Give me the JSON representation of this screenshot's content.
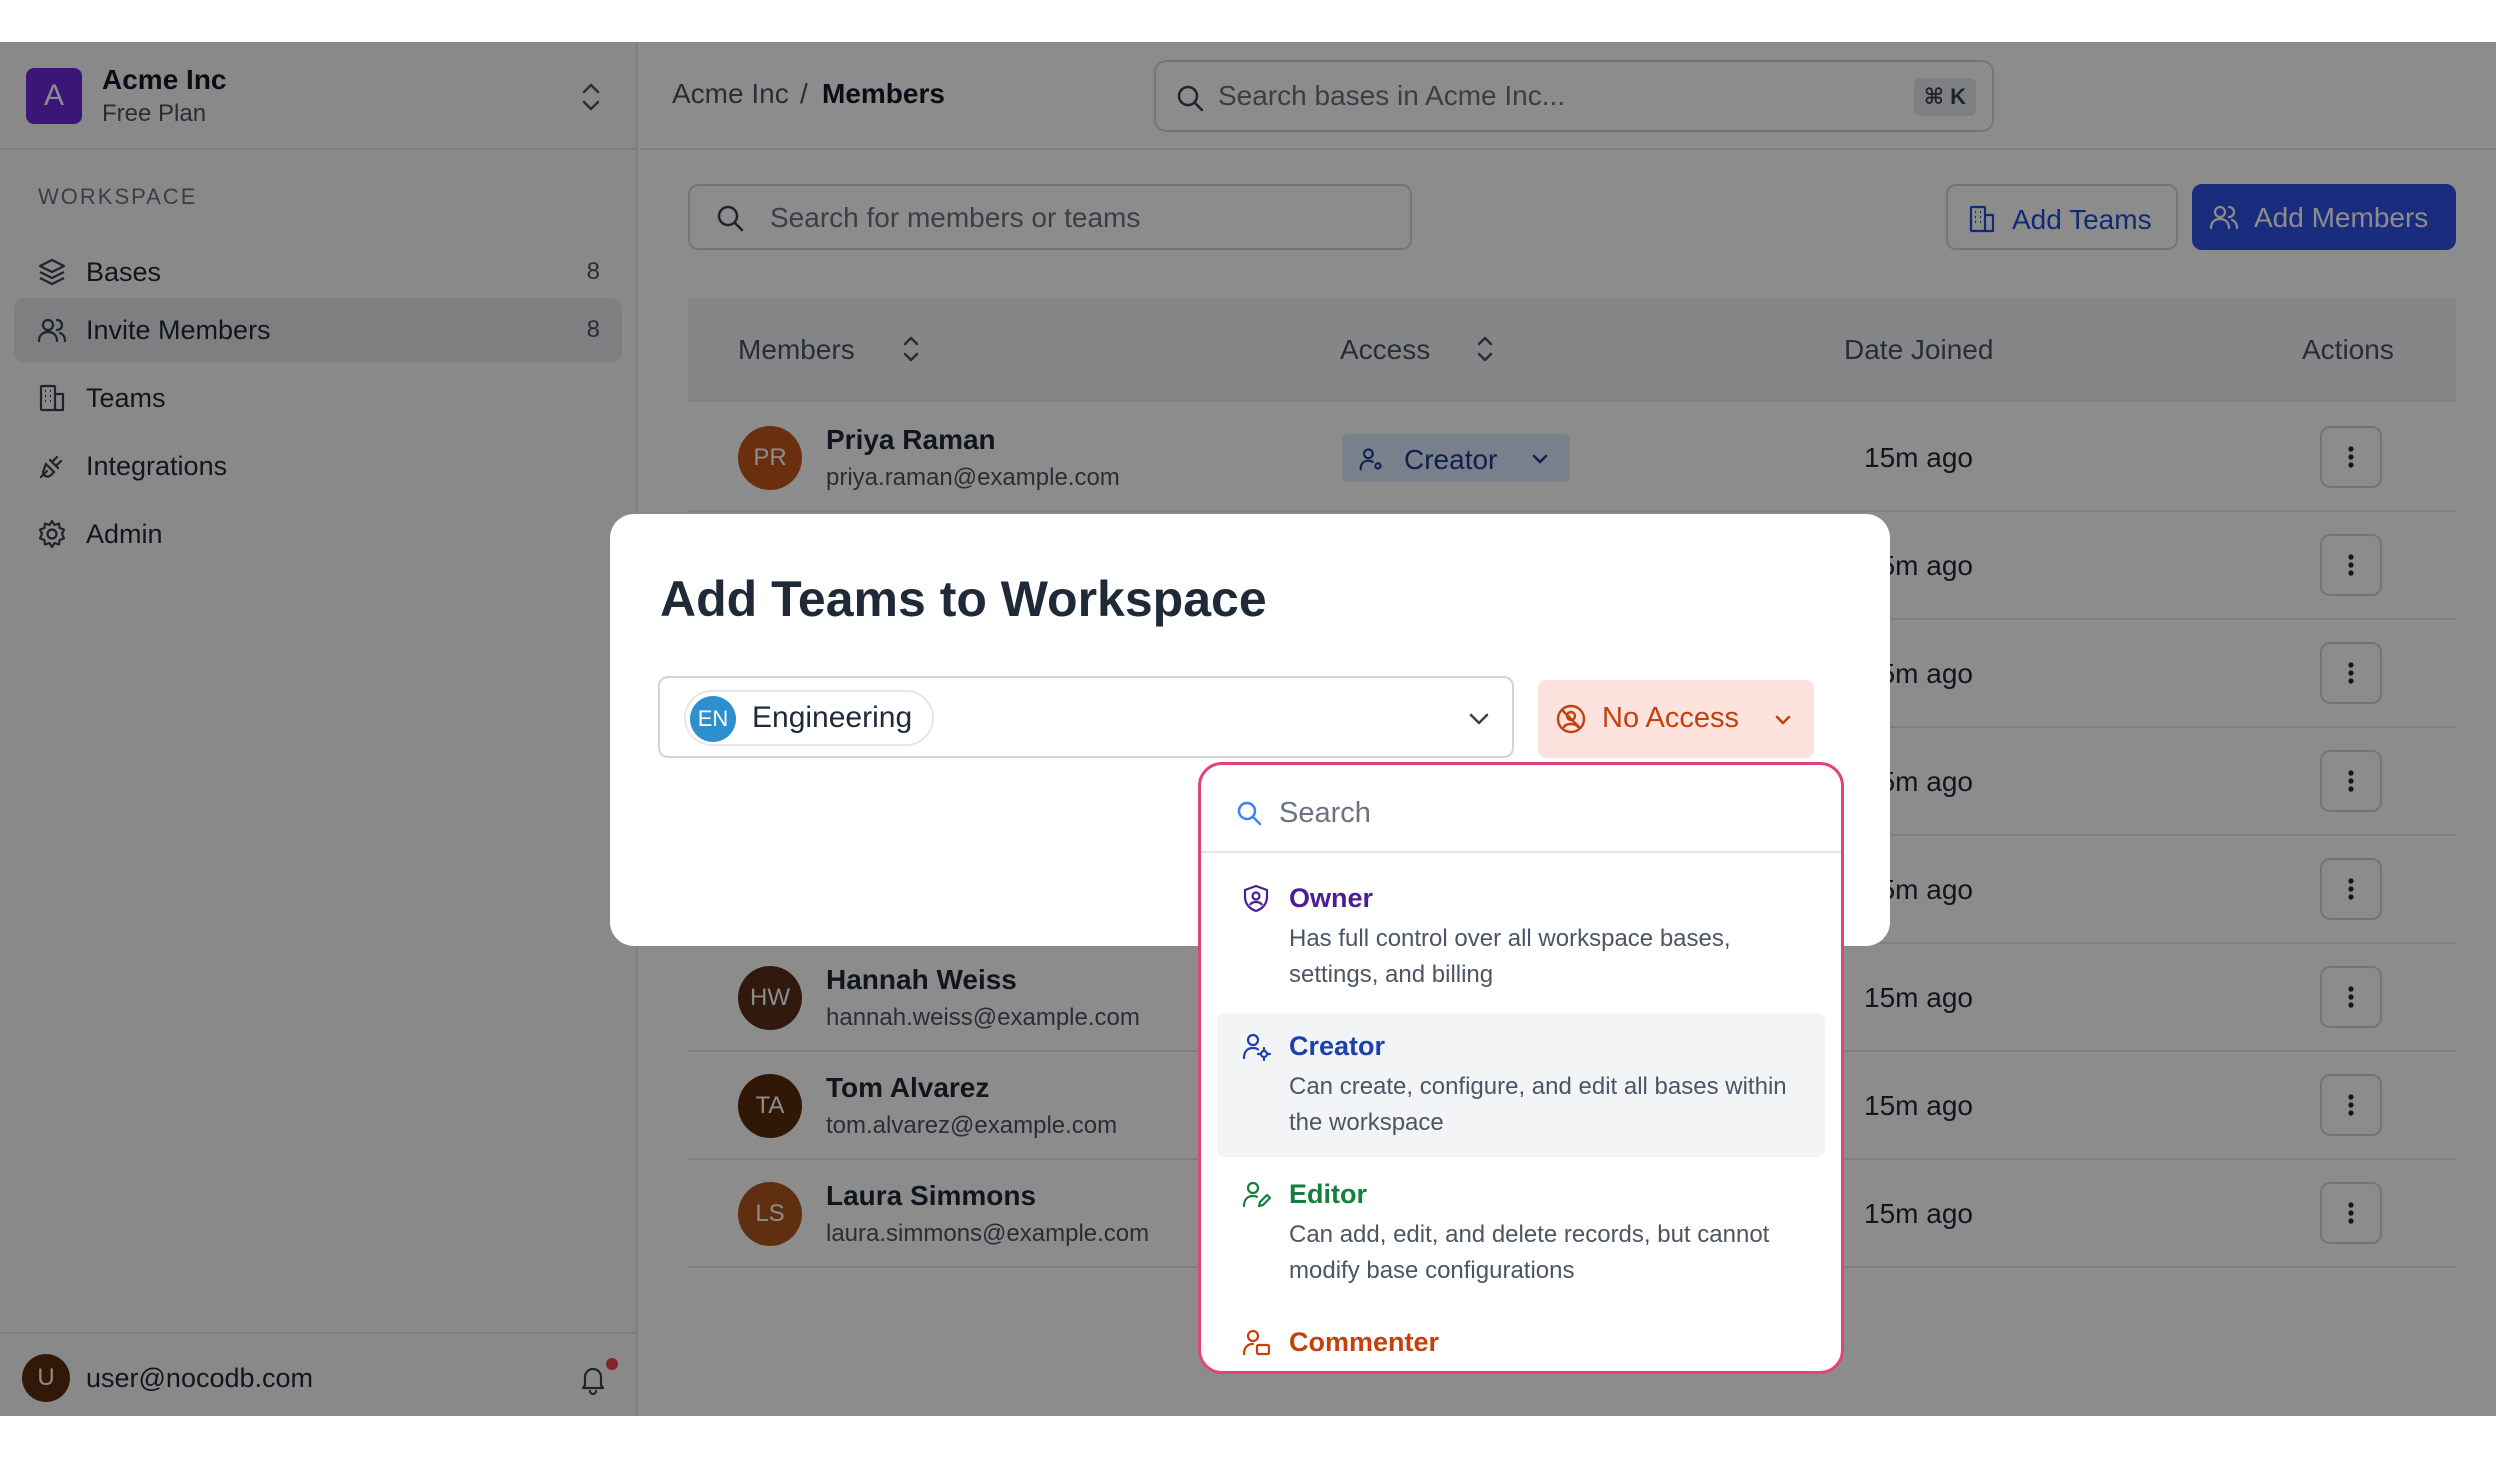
{
  "workspace": {
    "avatar_letter": "A",
    "name": "Acme Inc",
    "plan": "Free Plan"
  },
  "sidebar": {
    "section_label": "WORKSPACE",
    "items": [
      {
        "label": "Bases",
        "count": "8",
        "icon": "layers-icon"
      },
      {
        "label": "Invite Members",
        "count": "8",
        "icon": "users-icon",
        "active": true
      },
      {
        "label": "Teams",
        "count": "",
        "icon": "building-icon"
      },
      {
        "label": "Integrations",
        "count": "",
        "icon": "plug-icon"
      },
      {
        "label": "Admin",
        "count": "",
        "icon": "gear-icon"
      }
    ],
    "user": {
      "avatar_letter": "U",
      "email": "user@nocodb.com"
    }
  },
  "header": {
    "breadcrumb_parent": "Acme Inc",
    "breadcrumb_sep": "/",
    "breadcrumb_current": "Members",
    "search_placeholder": "Search bases in Acme Inc...",
    "search_shortcut": "⌘ K"
  },
  "toolbar": {
    "search_placeholder": "Search for members or teams",
    "add_teams_label": "Add Teams",
    "add_members_label": "Add Members"
  },
  "table": {
    "headers": {
      "members": "Members",
      "access": "Access",
      "date_joined": "Date Joined",
      "actions": "Actions"
    },
    "rows": [
      {
        "initials": "PR",
        "name": "Priya Raman",
        "email": "priya.raman@example.com",
        "role": "Creator",
        "date": "15m ago",
        "avatar_color": "#c2571d"
      },
      {
        "initials": "",
        "name": "",
        "email": "",
        "role": "",
        "date": "15m ago",
        "avatar_color": "#6b7280"
      },
      {
        "initials": "",
        "name": "",
        "email": "",
        "role": "",
        "date": "15m ago",
        "avatar_color": "#6b7280"
      },
      {
        "initials": "",
        "name": "",
        "email": "",
        "role": "",
        "date": "15m ago",
        "avatar_color": "#6b7280"
      },
      {
        "initials": "",
        "name": "",
        "email": "",
        "role": "",
        "date": "15m ago",
        "avatar_color": "#6b7280"
      },
      {
        "initials": "HW",
        "name": "Hannah Weiss",
        "email": "hannah.weiss@example.com",
        "role": "",
        "date": "15m ago",
        "avatar_color": "#5c2f18"
      },
      {
        "initials": "TA",
        "name": "Tom Alvarez",
        "email": "tom.alvarez@example.com",
        "role": "",
        "date": "15m ago",
        "avatar_color": "#5a2c0c"
      },
      {
        "initials": "LS",
        "name": "Laura Simmons",
        "email": "laura.simmons@example.com",
        "role": "",
        "date": "15m ago",
        "avatar_color": "#b0561f"
      }
    ]
  },
  "modal": {
    "title": "Add Teams to Workspace",
    "selected_team": {
      "initials": "EN",
      "name": "Engineering"
    },
    "access_label": "No Access",
    "dropdown": {
      "search_placeholder": "Search",
      "options": [
        {
          "title": "Owner",
          "desc": "Has full control over all workspace bases, settings, and billing",
          "color": "#4c1d95",
          "icon": "shield-user-icon"
        },
        {
          "title": "Creator",
          "desc": "Can create, configure, and edit all bases within the workspace",
          "color": "#1e40af",
          "icon": "user-gear-icon"
        },
        {
          "title": "Editor",
          "desc": "Can add, edit, and delete records, but cannot modify base configurations",
          "color": "#15803d",
          "icon": "user-edit-icon"
        },
        {
          "title": "Commenter",
          "desc": "",
          "color": "#c2410c",
          "icon": "user-comment-icon"
        }
      ]
    }
  },
  "colors": {
    "accent": "#3050e6",
    "danger": "#c2410c",
    "dropdown_border": "#e0447f"
  }
}
